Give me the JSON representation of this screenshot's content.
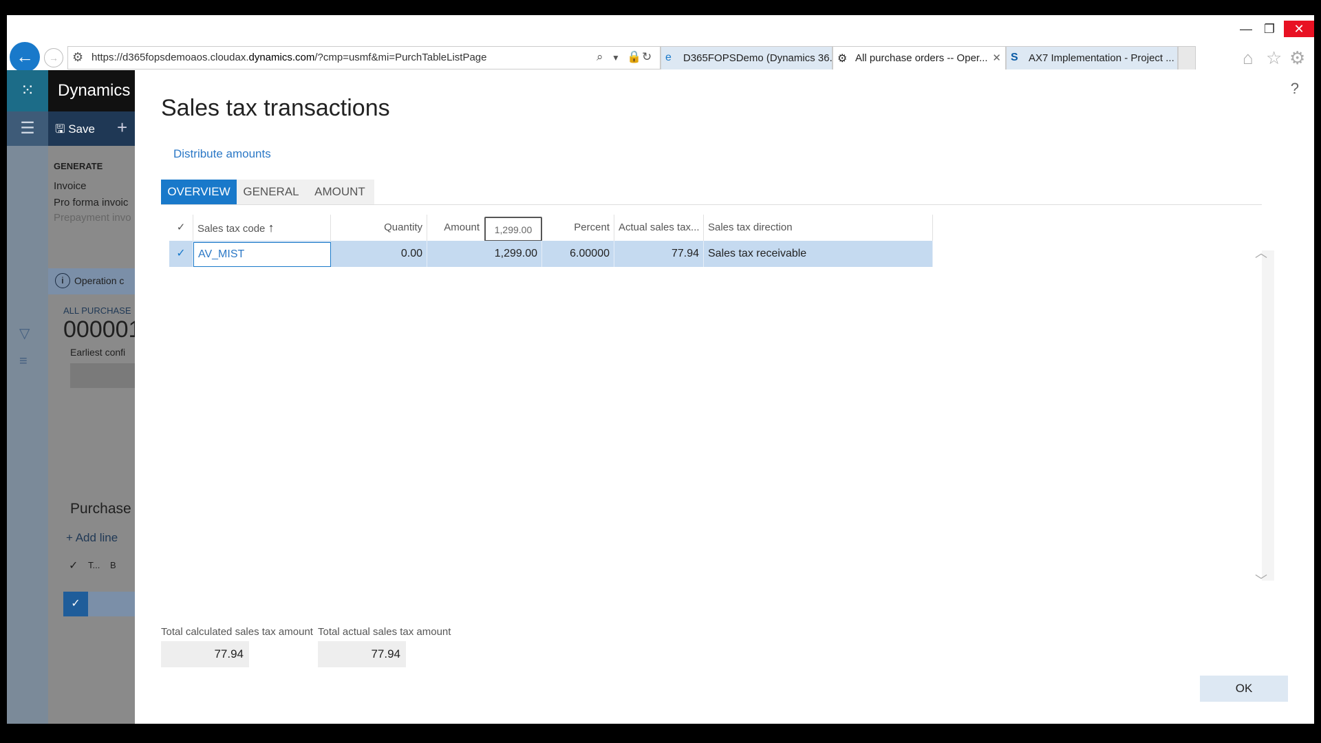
{
  "browser": {
    "url_prefix": "https://d365fopsdemoaos.cloudax.",
    "url_domain": "dynamics.com",
    "url_path": "/?cmp=usmf&mi=PurchTableListPage",
    "tabs": [
      {
        "label": "D365FOPSDemo (Dynamics 36...",
        "icon": "e"
      },
      {
        "label": "All purchase orders -- Oper...",
        "icon": "⚙"
      },
      {
        "label": "AX7 Implementation - Project ...",
        "icon": "S"
      }
    ]
  },
  "app": {
    "title": "Dynamics",
    "save_label": "Save",
    "generate_heading": "GENERATE",
    "generate_items": [
      "Invoice",
      "Pro forma invoic",
      "Prepayment invo"
    ],
    "operation_msg": "Operation c",
    "breadcrumb": "ALL PURCHASE",
    "record_id": "000001",
    "earliest_label": "Earliest confi",
    "lines_title": "Purchase",
    "add_line": "Add line",
    "lines_col_t": "T...",
    "lines_col_b": "B"
  },
  "dialog": {
    "title": "Sales tax transactions",
    "distribute_label": "Distribute amounts",
    "tabs": [
      "OVERVIEW",
      "GENERAL",
      "AMOUNT"
    ],
    "columns": {
      "code": "Sales tax code",
      "quantity": "Quantity",
      "amount": "Amount",
      "percent": "Percent",
      "actual": "Actual sales tax...",
      "direction": "Sales tax direction"
    },
    "amount_tooltip": "1,299.00",
    "row": {
      "code": "AV_MIST",
      "quantity": "0.00",
      "amount": "1,299.00",
      "percent": "6.00000",
      "actual": "77.94",
      "direction": "Sales tax receivable"
    },
    "total_calculated_label": "Total calculated sales tax amount",
    "total_calculated_value": "77.94",
    "total_actual_label": "Total actual sales tax amount",
    "total_actual_value": "77.94",
    "ok_label": "OK",
    "help": "?"
  }
}
